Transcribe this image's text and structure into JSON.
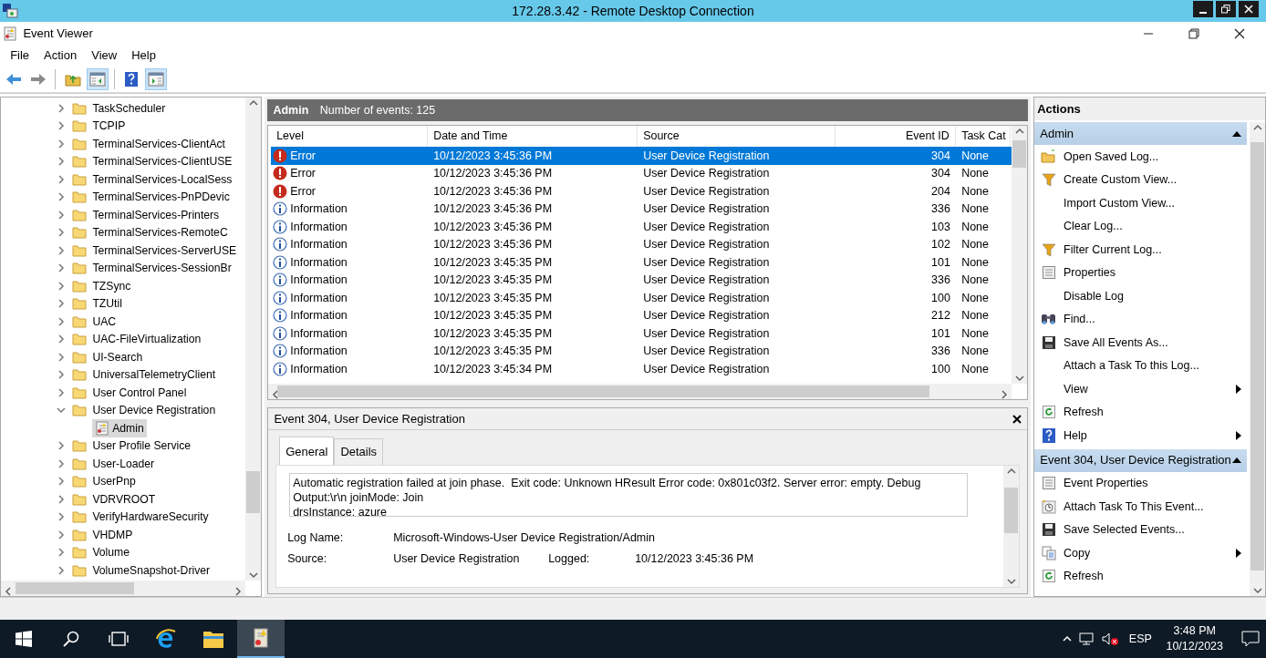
{
  "remote_window": {
    "title": "172.28.3.42 - Remote Desktop Connection"
  },
  "window": {
    "title": "Event Viewer"
  },
  "menu": [
    "File",
    "Action",
    "View",
    "Help"
  ],
  "toolbar": [
    {
      "kind": "back",
      "pressed": false
    },
    {
      "kind": "forward",
      "pressed": false
    },
    {
      "kind": "up",
      "pressed": false
    },
    {
      "kind": "tree",
      "pressed": true
    },
    {
      "kind": "help",
      "pressed": false
    },
    {
      "kind": "pane",
      "pressed": true
    }
  ],
  "tree": {
    "items": [
      {
        "label": "TaskScheduler",
        "expanded": false,
        "selected": false
      },
      {
        "label": "TCPIP",
        "expanded": false,
        "selected": false
      },
      {
        "label": "TerminalServices-ClientAct",
        "expanded": false,
        "selected": false
      },
      {
        "label": "TerminalServices-ClientUSE",
        "expanded": false,
        "selected": false
      },
      {
        "label": "TerminalServices-LocalSess",
        "expanded": false,
        "selected": false
      },
      {
        "label": "TerminalServices-PnPDevic",
        "expanded": false,
        "selected": false
      },
      {
        "label": "TerminalServices-Printers",
        "expanded": false,
        "selected": false
      },
      {
        "label": "TerminalServices-RemoteC",
        "expanded": false,
        "selected": false
      },
      {
        "label": "TerminalServices-ServerUSE",
        "expanded": false,
        "selected": false
      },
      {
        "label": "TerminalServices-SessionBr",
        "expanded": false,
        "selected": false
      },
      {
        "label": "TZSync",
        "expanded": false,
        "selected": false
      },
      {
        "label": "TZUtil",
        "expanded": false,
        "selected": false
      },
      {
        "label": "UAC",
        "expanded": false,
        "selected": false
      },
      {
        "label": "UAC-FileVirtualization",
        "expanded": false,
        "selected": false
      },
      {
        "label": "UI-Search",
        "expanded": false,
        "selected": false
      },
      {
        "label": "UniversalTelemetryClient",
        "expanded": false,
        "selected": false
      },
      {
        "label": "User Control Panel",
        "expanded": false,
        "selected": false
      },
      {
        "label": "User Device Registration",
        "expanded": true,
        "selected": false,
        "children": [
          {
            "label": "Admin",
            "selected": true
          }
        ]
      },
      {
        "label": "User Profile Service",
        "expanded": false,
        "selected": false
      },
      {
        "label": "User-Loader",
        "expanded": false,
        "selected": false
      },
      {
        "label": "UserPnp",
        "expanded": false,
        "selected": false
      },
      {
        "label": "VDRVROOT",
        "expanded": false,
        "selected": false
      },
      {
        "label": "VerifyHardwareSecurity",
        "expanded": false,
        "selected": false
      },
      {
        "label": "VHDMP",
        "expanded": false,
        "selected": false
      },
      {
        "label": "Volume",
        "expanded": false,
        "selected": false
      },
      {
        "label": "VolumeSnapshot-Driver",
        "expanded": false,
        "selected": false
      }
    ]
  },
  "log_header": {
    "name": "Admin",
    "count": "Number of events: 125"
  },
  "events": {
    "columns": [
      "Level",
      "Date and Time",
      "Source",
      "Event ID",
      "Task Cat"
    ],
    "rows": [
      {
        "kind": "error",
        "level": "Error",
        "date": "10/12/2023 3:45:36 PM",
        "source": "User Device Registration",
        "event_id": "304",
        "task_category": "None",
        "selected": true
      },
      {
        "kind": "error",
        "level": "Error",
        "date": "10/12/2023 3:45:36 PM",
        "source": "User Device Registration",
        "event_id": "304",
        "task_category": "None",
        "selected": false
      },
      {
        "kind": "error",
        "level": "Error",
        "date": "10/12/2023 3:45:36 PM",
        "source": "User Device Registration",
        "event_id": "204",
        "task_category": "None",
        "selected": false
      },
      {
        "kind": "info",
        "level": "Information",
        "date": "10/12/2023 3:45:36 PM",
        "source": "User Device Registration",
        "event_id": "336",
        "task_category": "None",
        "selected": false
      },
      {
        "kind": "info",
        "level": "Information",
        "date": "10/12/2023 3:45:36 PM",
        "source": "User Device Registration",
        "event_id": "103",
        "task_category": "None",
        "selected": false
      },
      {
        "kind": "info",
        "level": "Information",
        "date": "10/12/2023 3:45:36 PM",
        "source": "User Device Registration",
        "event_id": "102",
        "task_category": "None",
        "selected": false
      },
      {
        "kind": "info",
        "level": "Information",
        "date": "10/12/2023 3:45:35 PM",
        "source": "User Device Registration",
        "event_id": "101",
        "task_category": "None",
        "selected": false
      },
      {
        "kind": "info",
        "level": "Information",
        "date": "10/12/2023 3:45:35 PM",
        "source": "User Device Registration",
        "event_id": "336",
        "task_category": "None",
        "selected": false
      },
      {
        "kind": "info",
        "level": "Information",
        "date": "10/12/2023 3:45:35 PM",
        "source": "User Device Registration",
        "event_id": "100",
        "task_category": "None",
        "selected": false
      },
      {
        "kind": "info",
        "level": "Information",
        "date": "10/12/2023 3:45:35 PM",
        "source": "User Device Registration",
        "event_id": "212",
        "task_category": "None",
        "selected": false
      },
      {
        "kind": "info",
        "level": "Information",
        "date": "10/12/2023 3:45:35 PM",
        "source": "User Device Registration",
        "event_id": "101",
        "task_category": "None",
        "selected": false
      },
      {
        "kind": "info",
        "level": "Information",
        "date": "10/12/2023 3:45:35 PM",
        "source": "User Device Registration",
        "event_id": "336",
        "task_category": "None",
        "selected": false
      },
      {
        "kind": "info",
        "level": "Information",
        "date": "10/12/2023 3:45:34 PM",
        "source": "User Device Registration",
        "event_id": "100",
        "task_category": "None",
        "selected": false
      }
    ]
  },
  "detail": {
    "title": "Event 304, User Device Registration",
    "tabs": [
      {
        "label": "General",
        "selected": true
      },
      {
        "label": "Details",
        "selected": false
      }
    ],
    "message": "Automatic registration failed at join phase.  Exit code: Unknown HResult Error code: 0x801c03f2. Server error: empty. Debug Output:\\r\\n joinMode: Join\ndrsInstance: azure",
    "log_name": {
      "label": "Log Name:",
      "value": "Microsoft-Windows-User Device Registration/Admin"
    },
    "source": {
      "label": "Source:",
      "value": "User Device Registration"
    },
    "logged": {
      "label": "Logged:",
      "value": "10/12/2023 3:45:36 PM"
    }
  },
  "actions": {
    "title": "Actions",
    "sections": [
      {
        "title": "Admin",
        "items": [
          {
            "label": "Open Saved Log...",
            "kind": "folder",
            "submenu": false
          },
          {
            "label": "Create Custom View...",
            "kind": "filter",
            "submenu": false
          },
          {
            "label": "Import Custom View...",
            "kind": "none",
            "submenu": false
          },
          {
            "label": "Clear Log...",
            "kind": "none",
            "submenu": false
          },
          {
            "label": "Filter Current Log...",
            "kind": "filter",
            "submenu": false
          },
          {
            "label": "Properties",
            "kind": "properties",
            "submenu": false
          },
          {
            "label": "Disable Log",
            "kind": "none",
            "submenu": false
          },
          {
            "label": "Find...",
            "kind": "find",
            "submenu": false
          },
          {
            "label": "Save All Events As...",
            "kind": "save",
            "submenu": false
          },
          {
            "label": "Attach a Task To this Log...",
            "kind": "none",
            "submenu": false
          },
          {
            "label": "View",
            "kind": "none",
            "submenu": true
          },
          {
            "label": "Refresh",
            "kind": "refresh",
            "submenu": false
          },
          {
            "label": "Help",
            "kind": "help",
            "submenu": true
          }
        ]
      },
      {
        "title": "Event 304, User Device Registration",
        "items": [
          {
            "label": "Event Properties",
            "kind": "properties",
            "submenu": false
          },
          {
            "label": "Attach Task To This Event...",
            "kind": "task",
            "submenu": false
          },
          {
            "label": "Save Selected Events...",
            "kind": "save",
            "submenu": false
          },
          {
            "label": "Copy",
            "kind": "copy",
            "submenu": true
          },
          {
            "label": "Refresh",
            "kind": "refresh",
            "submenu": false
          }
        ]
      }
    ]
  },
  "taskbar": {
    "items": [
      {
        "kind": "start",
        "selected": false
      },
      {
        "kind": "search",
        "selected": false
      },
      {
        "kind": "taskview",
        "selected": false
      },
      {
        "kind": "browser",
        "selected": false
      },
      {
        "kind": "files",
        "selected": false
      },
      {
        "kind": "eventviewer",
        "selected": true
      }
    ],
    "language": "ESP",
    "time": "3:48 PM",
    "date": "10/12/2023"
  }
}
